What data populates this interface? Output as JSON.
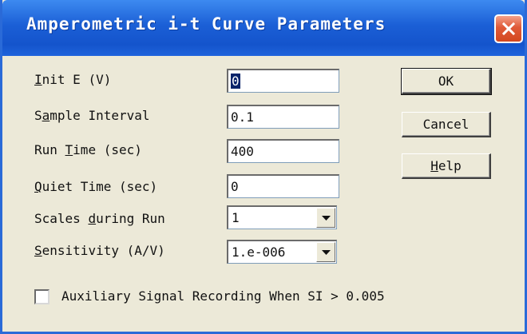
{
  "window": {
    "title": "Amperometric i-t Curve Parameters"
  },
  "fields": {
    "init_e": {
      "label_first": "I",
      "label_rest": "nit E (V)",
      "value": "0"
    },
    "sample_interval": {
      "label_pre": "S",
      "label_u": "a",
      "label_post": "mple Interval",
      "value": "0.1"
    },
    "run_time": {
      "label_pre": "Run ",
      "label_u": "T",
      "label_post": "ime (sec)",
      "value": "400"
    },
    "quiet_time": {
      "label_u": "Q",
      "label_post": "uiet Time (sec)",
      "value": "0"
    },
    "scales": {
      "label_pre": "Scales ",
      "label_u": "d",
      "label_post": "uring Run",
      "value": "1"
    },
    "sensitivity": {
      "label_u": "S",
      "label_post": "ensitivity (A/V)",
      "value": "1.e-006"
    }
  },
  "buttons": {
    "ok": "OK",
    "cancel": "Cancel",
    "help_u": "H",
    "help_rest": "elp"
  },
  "checkbox": {
    "label": "Auxiliary Signal Recording When SI > 0.005",
    "checked": false
  },
  "colors": {
    "titlebar": "#1b5fd6",
    "close_button": "#e05a38",
    "dialog_bg": "#ece9d8",
    "selection": "#0a246a"
  },
  "icons": {
    "close": "close-icon",
    "dropdown": "chevron-down-icon"
  }
}
